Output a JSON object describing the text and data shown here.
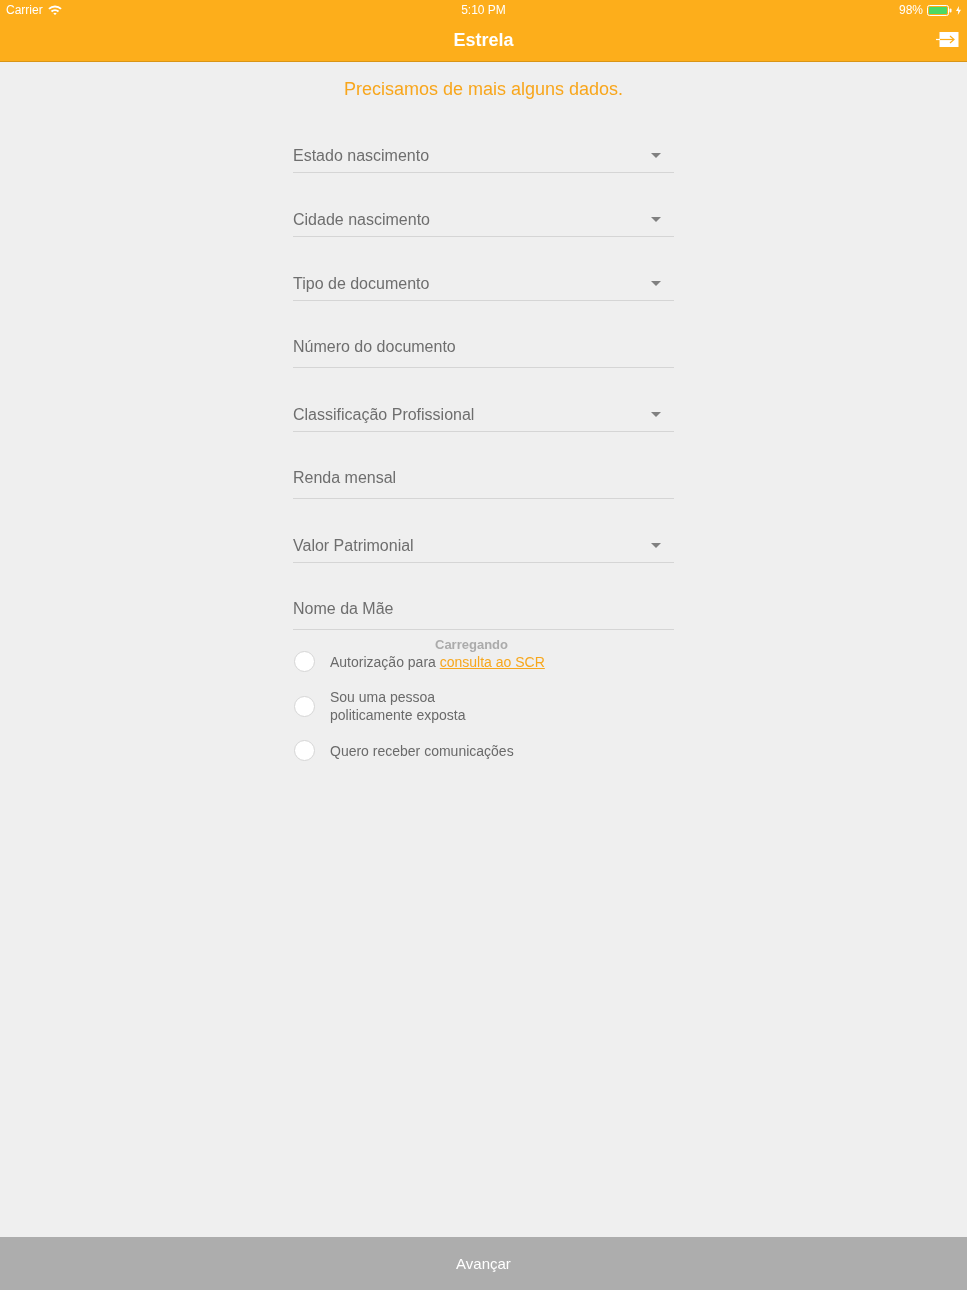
{
  "status_bar": {
    "carrier": "Carrier",
    "time": "5:10 PM",
    "battery": "98%",
    "charging": true
  },
  "nav_bar": {
    "title": "Estrela"
  },
  "heading": "Precisamos de mais alguns dados.",
  "fields": [
    {
      "kind": "dropdown",
      "placeholder": "Estado nascimento"
    },
    {
      "kind": "dropdown",
      "placeholder": "Cidade nascimento"
    },
    {
      "kind": "dropdown",
      "placeholder": "Tipo de documento"
    },
    {
      "kind": "text",
      "placeholder": "Número do documento"
    },
    {
      "kind": "dropdown",
      "placeholder": "Classificação Profissional"
    },
    {
      "kind": "text",
      "placeholder": "Renda mensal"
    },
    {
      "kind": "dropdown",
      "placeholder": "Valor Patrimonial"
    },
    {
      "kind": "text",
      "placeholder": "Nome da Mãe"
    }
  ],
  "loading_text": "Carregando",
  "options": [
    {
      "text": "Autorização para",
      "link": "consulta ao SCR",
      "checked": false
    },
    {
      "text": "Sou uma pessoa\npoliticamente exposta",
      "checked": false
    },
    {
      "text": "Quero receber comunicações",
      "checked": false
    }
  ],
  "next_button": {
    "label": "Avançar",
    "disabled": true
  }
}
